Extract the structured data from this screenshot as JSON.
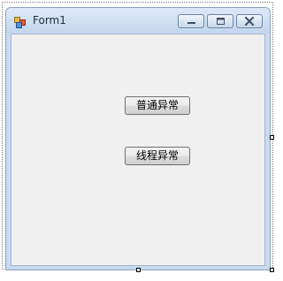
{
  "window": {
    "title": "Form1",
    "icon": "form-icon",
    "caption_buttons": [
      "minimize-icon",
      "maximize-icon",
      "close-icon"
    ]
  },
  "buttons": {
    "normal_exception_label": "普通异常",
    "thread_exception_label": "线程异常"
  },
  "colors": {
    "client_background": "#f0f0f0",
    "titlebar": "#cfe0f3",
    "window_frame": "#c9dbf0"
  }
}
